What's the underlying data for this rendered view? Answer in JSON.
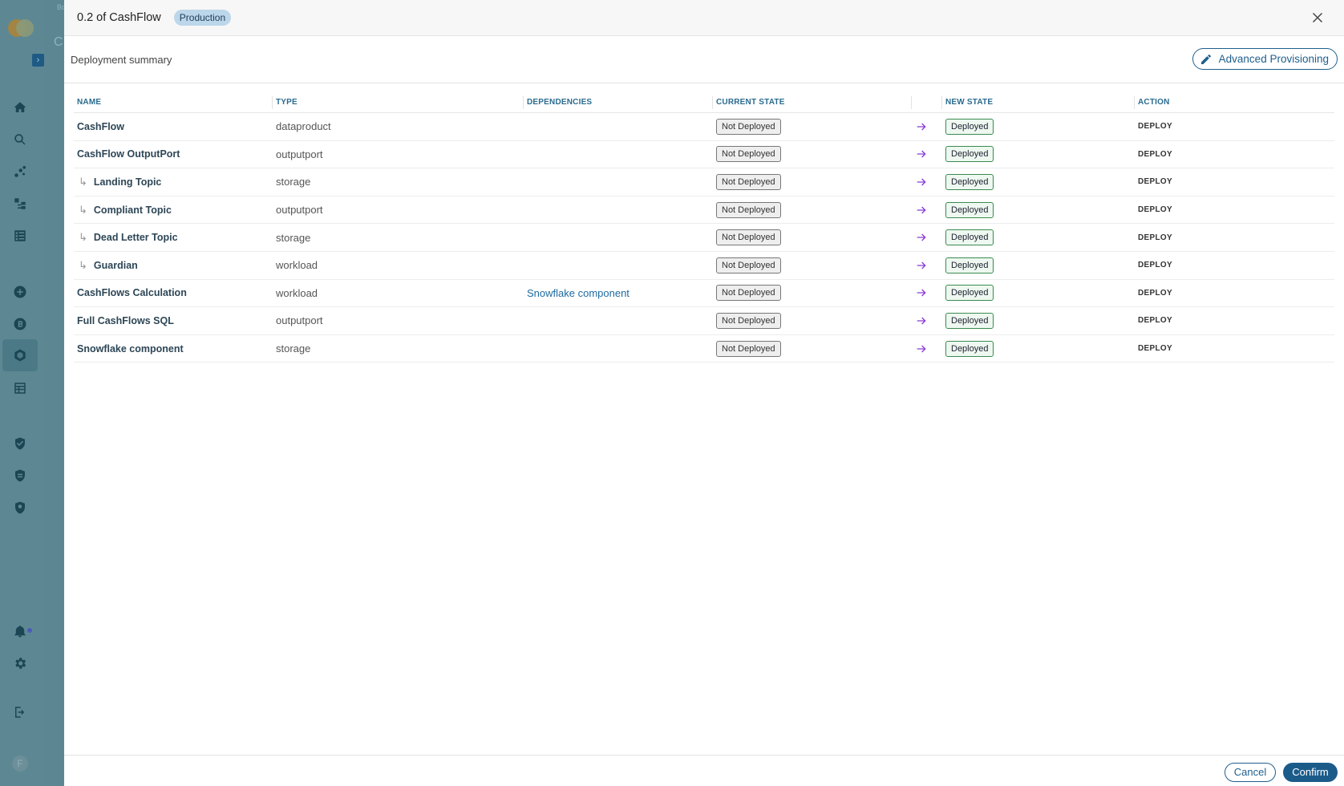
{
  "background": {
    "crumb_text": "Bo",
    "heading_initial": "C",
    "user_initial": "F",
    "nav_icons": [
      "home-icon",
      "search-icon",
      "graph-icon",
      "hierarchy-icon",
      "checklist-icon",
      "add-circle-icon",
      "badge-b-icon",
      "hexagon-icon",
      "table-icon",
      "shield-check-icon",
      "shield-doc-icon",
      "shield-search-icon",
      "bell-icon",
      "gear-icon",
      "logout-icon"
    ]
  },
  "modal": {
    "title": "0.2 of CashFlow",
    "environment": "Production",
    "summary_label": "Deployment summary",
    "advanced_button": "Advanced Provisioning",
    "cancel_label": "Cancel",
    "confirm_label": "Confirm"
  },
  "table": {
    "headers": {
      "name": "NAME",
      "type": "TYPE",
      "dependencies": "DEPENDENCIES",
      "current_state": "CURRENT STATE",
      "new_state": "NEW STATE",
      "action": "ACTION"
    },
    "rows": [
      {
        "name": "CashFlow",
        "child": false,
        "type": "dataproduct",
        "dependency": "",
        "current": "Not Deployed",
        "new": "Deployed",
        "action": "DEPLOY"
      },
      {
        "name": "CashFlow OutputPort",
        "child": false,
        "type": "outputport",
        "dependency": "",
        "current": "Not Deployed",
        "new": "Deployed",
        "action": "DEPLOY"
      },
      {
        "name": "Landing Topic",
        "child": true,
        "type": "storage",
        "dependency": "",
        "current": "Not Deployed",
        "new": "Deployed",
        "action": "DEPLOY"
      },
      {
        "name": "Compliant Topic",
        "child": true,
        "type": "outputport",
        "dependency": "",
        "current": "Not Deployed",
        "new": "Deployed",
        "action": "DEPLOY"
      },
      {
        "name": "Dead Letter Topic",
        "child": true,
        "type": "storage",
        "dependency": "",
        "current": "Not Deployed",
        "new": "Deployed",
        "action": "DEPLOY"
      },
      {
        "name": "Guardian",
        "child": true,
        "type": "workload",
        "dependency": "",
        "current": "Not Deployed",
        "new": "Deployed",
        "action": "DEPLOY"
      },
      {
        "name": "CashFlows Calculation",
        "child": false,
        "type": "workload",
        "dependency": "Snowflake component",
        "current": "Not Deployed",
        "new": "Deployed",
        "action": "DEPLOY"
      },
      {
        "name": "Full CashFlows SQL",
        "child": false,
        "type": "outputport",
        "dependency": "",
        "current": "Not Deployed",
        "new": "Deployed",
        "action": "DEPLOY"
      },
      {
        "name": "Snowflake component",
        "child": false,
        "type": "storage",
        "dependency": "",
        "current": "Not Deployed",
        "new": "Deployed",
        "action": "DEPLOY"
      }
    ]
  },
  "colors": {
    "accent": "#1f5f8c",
    "transition_arrow": "#8a3ad6",
    "deployed_border": "#3a8a50"
  }
}
